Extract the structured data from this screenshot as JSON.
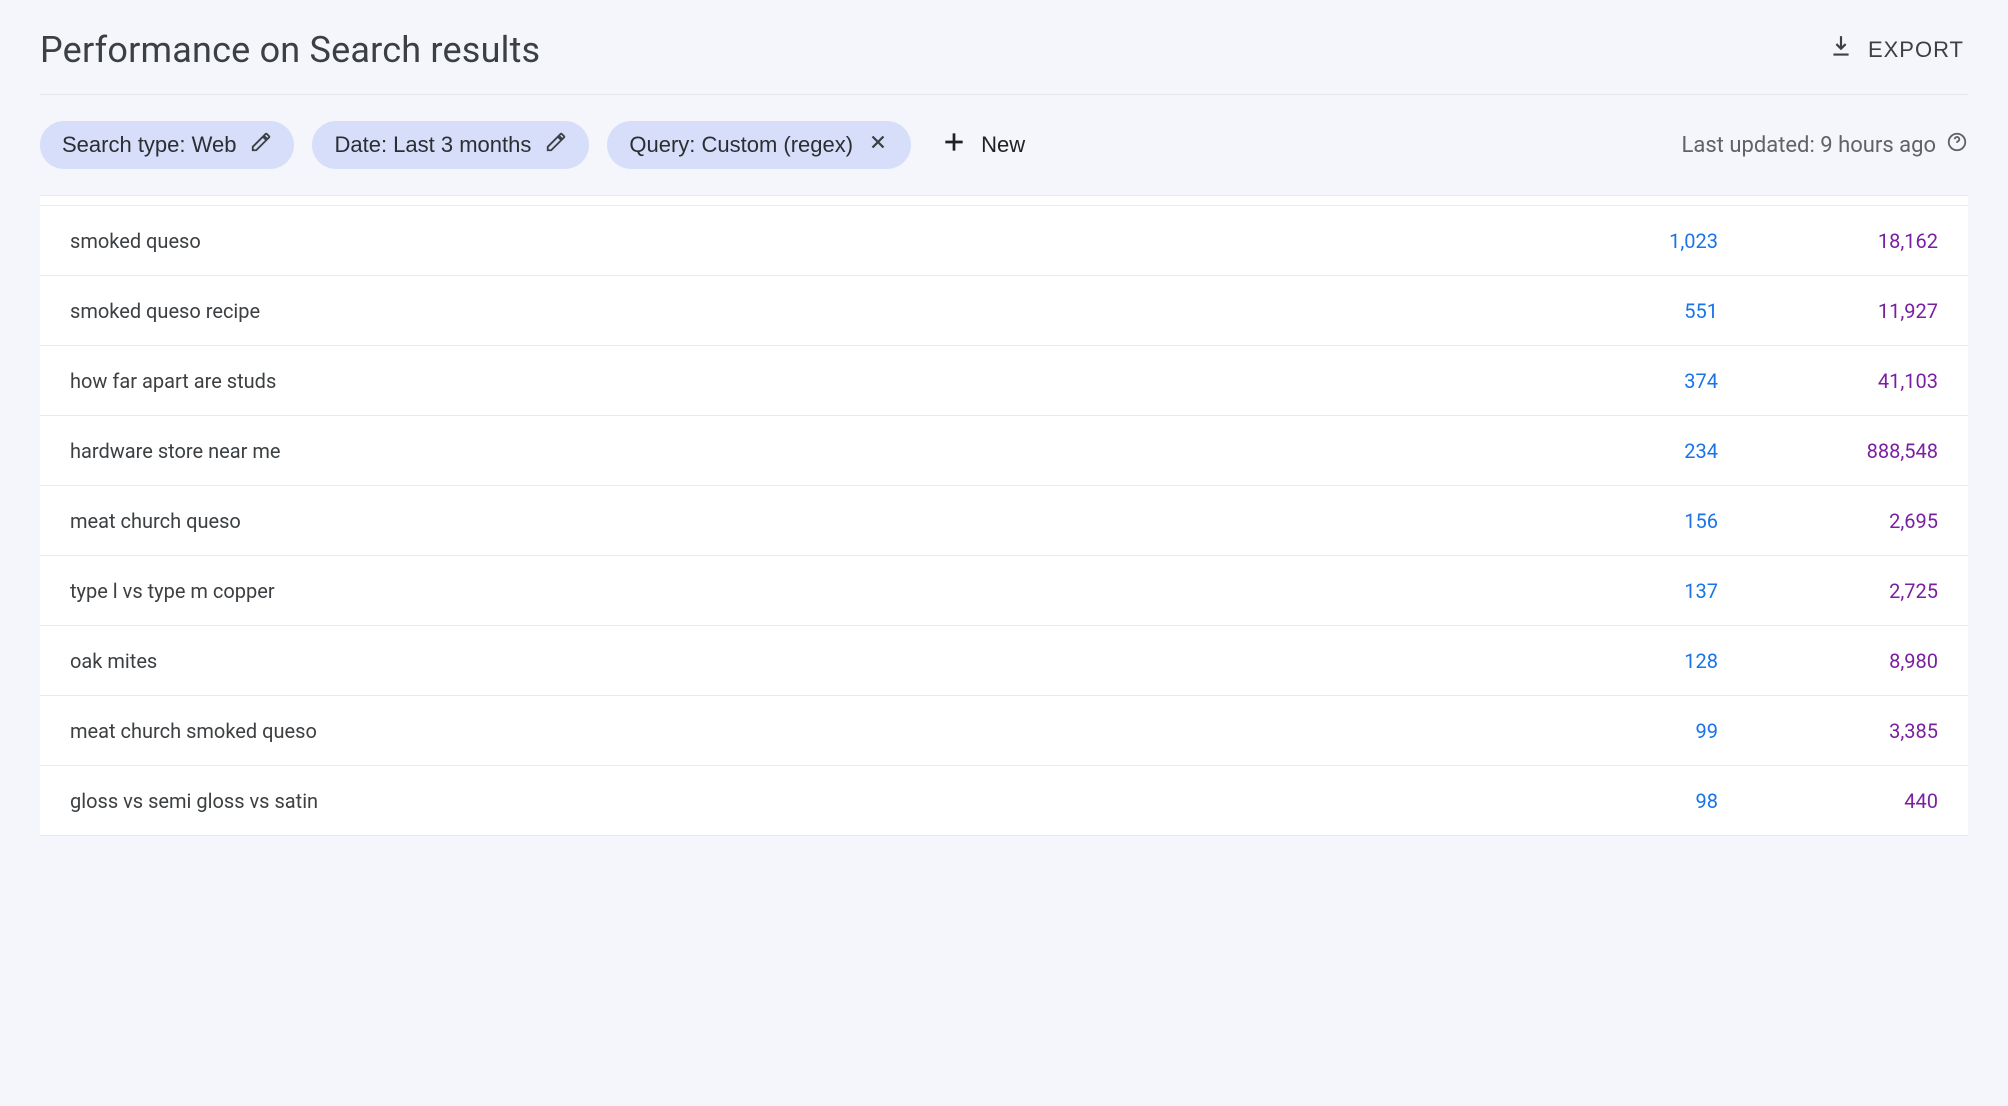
{
  "header": {
    "title": "Performance on Search results",
    "export_label": "EXPORT"
  },
  "filters": {
    "chips": [
      {
        "label": "Search type: Web",
        "icon": "pencil"
      },
      {
        "label": "Date: Last 3 months",
        "icon": "pencil"
      },
      {
        "label": "Query: Custom (regex)",
        "icon": "close"
      }
    ],
    "new_label": "New",
    "last_updated": "Last updated: 9 hours ago"
  },
  "table": {
    "rows": [
      {
        "query": "smoked queso",
        "clicks": "1,023",
        "impressions": "18,162"
      },
      {
        "query": "smoked queso recipe",
        "clicks": "551",
        "impressions": "11,927"
      },
      {
        "query": "how far apart are studs",
        "clicks": "374",
        "impressions": "41,103"
      },
      {
        "query": "hardware store near me",
        "clicks": "234",
        "impressions": "888,548"
      },
      {
        "query": "meat church queso",
        "clicks": "156",
        "impressions": "2,695"
      },
      {
        "query": "type l vs type m copper",
        "clicks": "137",
        "impressions": "2,725"
      },
      {
        "query": "oak mites",
        "clicks": "128",
        "impressions": "8,980"
      },
      {
        "query": "meat church smoked queso",
        "clicks": "99",
        "impressions": "3,385"
      },
      {
        "query": "gloss vs semi gloss vs satin",
        "clicks": "98",
        "impressions": "440"
      }
    ]
  }
}
